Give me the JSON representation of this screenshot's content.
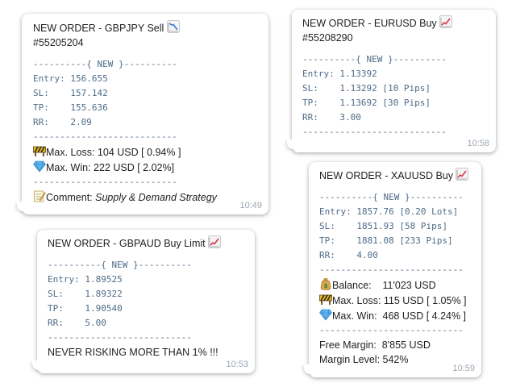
{
  "messages": [
    {
      "title": "NEW ORDER - GBPJPY Sell",
      "title_icon": "chart-decreasing-icon",
      "ticket": "#55205204",
      "lines": [
        "----------{ NEW }----------",
        "Entry: 156.655",
        "SL:    157.142",
        "TP:    155.636",
        "RR:    2.09",
        "---------------------------"
      ],
      "max_loss": "Max. Loss: 104 USD [ 0.94% ]",
      "max_win": "Max. Win:  222 USD [ 2.02%]",
      "separator": "---------------------------",
      "comment_label": "Comment: ",
      "comment_value": "Supply & Demand Strategy",
      "time": "10:49"
    },
    {
      "title": "NEW ORDER - EURUSD Buy",
      "title_icon": "chart-increasing-icon",
      "ticket": "#55208290",
      "lines": [
        "----------{ NEW }----------",
        "Entry: 1.13392",
        "SL:    1.13292 [10 Pips]",
        "TP:    1.13692 [30 Pips]",
        "RR:    3.00",
        "---------------------------"
      ],
      "time": "10:58"
    },
    {
      "title": "NEW ORDER - XAUUSD Buy",
      "title_icon": "chart-increasing-icon",
      "lines": [
        "----------{ NEW }----------",
        "Entry: 1857.76 [0.20 Lots]",
        "SL:    1851.93 [58 Pips]",
        "TP:    1881.08 [233 Pips]",
        "RR:    4.00",
        "---------------------------"
      ],
      "balance": "Balance:    11'023 USD",
      "max_loss": "Max. Loss: 115 USD [ 1.05% ]",
      "max_win": "Max. Win:  468 USD [ 4.24% ]",
      "separator": "---------------------------",
      "free_margin": "Free Margin:  8'855 USD",
      "margin_level": "Margin Level: 542%",
      "time": "10:59"
    },
    {
      "title": "NEW ORDER - GBPAUD Buy Limit",
      "title_icon": "chart-increasing-icon",
      "lines": [
        "----------{ NEW }----------",
        "Entry: 1.89525",
        "SL:    1.89322",
        "TP:    1.90540",
        "RR:    5.00",
        "---------------------------"
      ],
      "footer": "NEVER RISKING MORE THAN 1% !!!",
      "time": "10:53"
    }
  ],
  "colors": {
    "mono_text": "#4e6b88",
    "time_text": "#9aa7b3",
    "chart_up": "#d9374a",
    "chart_down": "#3a78d4"
  }
}
